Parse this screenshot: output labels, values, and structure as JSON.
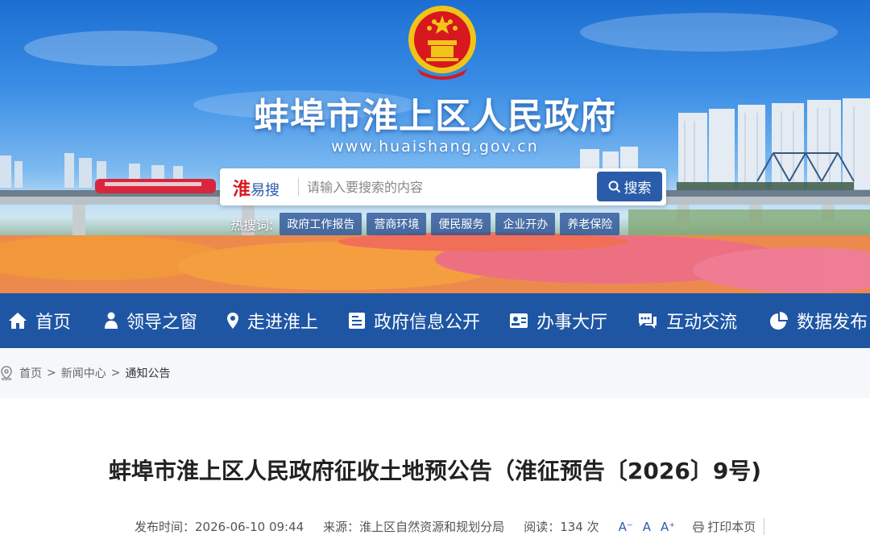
{
  "header": {
    "site_title": "蚌埠市淮上区人民政府",
    "site_url": "www.huaishang.gov.cn"
  },
  "search": {
    "brand_huai": "淮",
    "brand_yisou": "易搜",
    "placeholder": "请输入要搜索的内容",
    "button_label": "搜索"
  },
  "hot_search": {
    "label": "热搜词:",
    "tags": [
      "政府工作报告",
      "营商环境",
      "便民服务",
      "企业开办",
      "养老保险"
    ]
  },
  "nav": {
    "items": [
      {
        "label": "首页",
        "icon": "home-icon"
      },
      {
        "label": "领导之窗",
        "icon": "person-icon"
      },
      {
        "label": "走进淮上",
        "icon": "location-pin-icon"
      },
      {
        "label": "政府信息公开",
        "icon": "document-icon"
      },
      {
        "label": "办事大厅",
        "icon": "id-card-icon"
      },
      {
        "label": "互动交流",
        "icon": "chat-icon"
      },
      {
        "label": "数据发布",
        "icon": "pie-chart-icon"
      }
    ]
  },
  "breadcrumb": {
    "home": "首页",
    "sep": ">",
    "level1": "新闻中心",
    "current": "通知公告"
  },
  "article": {
    "title": "蚌埠市淮上区人民政府征收土地预公告（淮征预告〔2026〕9号)",
    "publish_time": "发布时间：2026-06-10 09:44",
    "source": "来源：淮上区自然资源和规划分局",
    "views": "阅读：134 次",
    "font_small": "A⁻",
    "font_normal": "A",
    "font_large": "A⁺",
    "print_label": "打印本页"
  },
  "colors": {
    "nav_bg": "#1f56a4",
    "accent": "#2a5caa",
    "brand_red": "#d7181e"
  }
}
